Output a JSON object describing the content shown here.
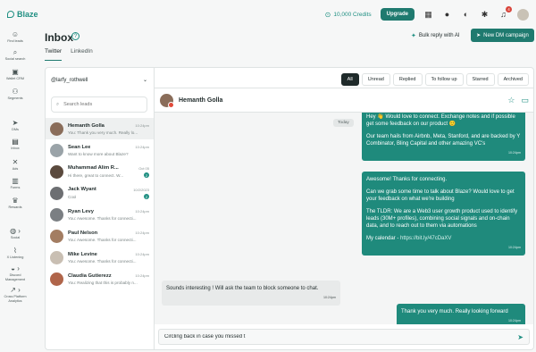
{
  "brand": {
    "name": "Blaze"
  },
  "topbar": {
    "credits": "10,000 Credits",
    "upgrade_label": "Upgrade",
    "notification_count": "4"
  },
  "sidebar": {
    "items": [
      {
        "label": "Find leads",
        "icon": "people-icon"
      },
      {
        "label": "Social search",
        "icon": "search-icon"
      },
      {
        "label": "Wallet CRM",
        "icon": "wallet-icon"
      },
      {
        "label": "Segments",
        "icon": "segments-icon"
      },
      {
        "label": "DMs",
        "icon": "send-icon"
      },
      {
        "label": "Inbox",
        "icon": "inbox-icon"
      },
      {
        "label": "Ads",
        "icon": "x-icon"
      },
      {
        "label": "Forms",
        "icon": "forms-icon"
      },
      {
        "label": "Rewards",
        "icon": "trophy-icon"
      },
      {
        "label": "Social",
        "icon": "chat-icon"
      },
      {
        "label": "X Listening",
        "icon": "listening-icon"
      },
      {
        "label": "Discord Management",
        "icon": "discord-icon"
      },
      {
        "label": "Cross Platform Analytics",
        "icon": "analytics-icon"
      }
    ]
  },
  "header": {
    "title": "Inbox",
    "bulk_reply_label": "Bulk reply with AI",
    "new_dm_label": "New DM campaign"
  },
  "tabs": [
    {
      "label": "Twitter",
      "active": true
    },
    {
      "label": "LinkedIn",
      "active": false
    }
  ],
  "leads_panel": {
    "account": "@larfy_rothwell",
    "search_placeholder": "Search leads",
    "leads": [
      {
        "name": "Hemanth Golla",
        "time": "10:24pm",
        "preview": "You: Thank you very much. Really lo...",
        "unread": "",
        "avatar_color": "#8a6d5a"
      },
      {
        "name": "Sean Lee",
        "time": "10:24pm",
        "preview": "Want to know more about Blaze?",
        "unread": "",
        "avatar_color": "#9aa3a8"
      },
      {
        "name": "Muhammad Alim R...",
        "time": "Oct 05",
        "preview": "Hi there, great to connect. W...",
        "unread": "2",
        "avatar_color": "#5b4a3e"
      },
      {
        "name": "Jack Wyant",
        "time": "10/2/2023",
        "preview": "Cool",
        "unread": "2",
        "avatar_color": "#6d6f72"
      },
      {
        "name": "Ryan Levy",
        "time": "10:24pm",
        "preview": "You: Awesome. Thanks for connecti...",
        "unread": "",
        "avatar_color": "#7b7f83"
      },
      {
        "name": "Paul Nelson",
        "time": "10:24pm",
        "preview": "You: Awesome. Thanks for connecti...",
        "unread": "",
        "avatar_color": "#a37d62"
      },
      {
        "name": "Mike Levine",
        "time": "10:24pm",
        "preview": "You: Awesome. Thanks for connecti...",
        "unread": "",
        "avatar_color": "#c9bfb3"
      },
      {
        "name": "Claudia Gutierezz",
        "time": "10:24pm",
        "preview": "You: Realizing that this is probably n...",
        "unread": "",
        "avatar_color": "#b0654a"
      }
    ]
  },
  "chat": {
    "filters": [
      "All",
      "Unread",
      "Replied",
      "To follow up",
      "Starred",
      "Archived"
    ],
    "active_filter": "All",
    "contact_name": "Hemanth Golla",
    "day_label": "Today",
    "messages": [
      {
        "dir": "out",
        "text": "Hey 👋 Would love to connect. Exchange notes and if possible get some feedback on our product 🙂",
        "text2": "Our team hails from Airbnb, Meta, Stanford, and are backed by Y Combinator, Bling Capital and other amazing VC's",
        "time": "10:24pm"
      },
      {
        "dir": "out",
        "text": "Awesome! Thanks for connecting.",
        "text2": "Can we grab some time to talk about Blaze? Would love to get your feedback on what we're building",
        "text3": "The TLDR: We are a Web3 user growth product used to identify leads (30M+ profiles), combining social signals and on-chain data, and to reach out to them via automations",
        "text4": "My calendar - ",
        "link": "https://bit.ly/47cDaXV",
        "time": "10:24pm"
      },
      {
        "dir": "in",
        "text": "Sounds interesting ! Will ask the team to block someone to chat.",
        "time": "10:24pm"
      },
      {
        "dir": "out",
        "text": "Thank you very much. Really looking forward",
        "time": "10:24pm"
      }
    ],
    "composer_value": "Circling back in case you missed t"
  }
}
